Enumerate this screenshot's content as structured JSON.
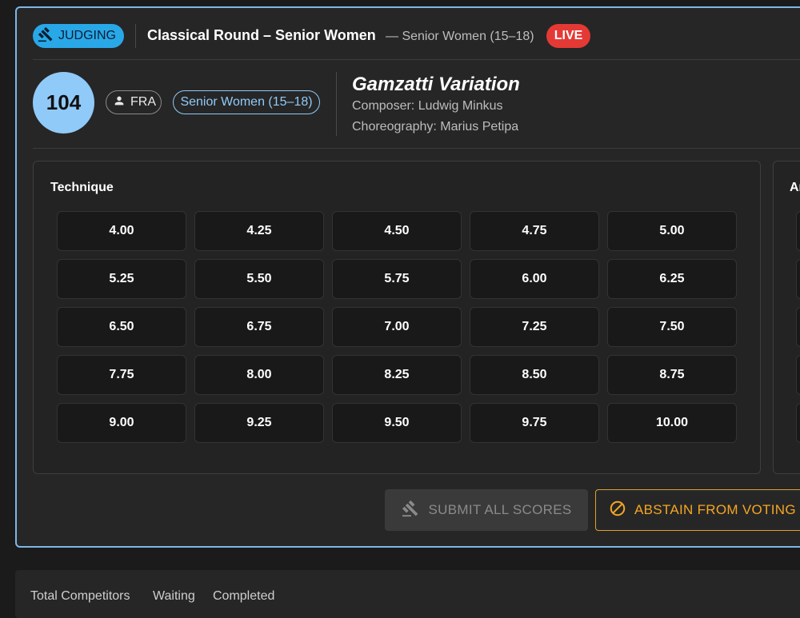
{
  "header": {
    "mode_badge": "JUDGING",
    "round_title": "Classical Round – Senior Women",
    "round_subtitle": "— Senior Women (15–18)",
    "live_badge": "LIVE"
  },
  "competitor": {
    "bib_number": "104",
    "country": "FRA",
    "category": "Senior Women (15–18)",
    "piece_title": "Gamzatti Variation",
    "composer": "Composer: Ludwig Minkus",
    "choreography": "Choreography: Marius Petipa"
  },
  "technique": {
    "title": "Technique",
    "scores": [
      "4.00",
      "4.25",
      "4.50",
      "4.75",
      "5.00",
      "5.25",
      "5.50",
      "5.75",
      "6.00",
      "6.25",
      "6.50",
      "6.75",
      "7.00",
      "7.25",
      "7.50",
      "7.75",
      "8.00",
      "8.25",
      "8.50",
      "8.75",
      "9.00",
      "9.25",
      "9.50",
      "9.75",
      "10.00"
    ]
  },
  "artistry": {
    "title": "Ar"
  },
  "actions": {
    "submit_label": "SUBMIT ALL SCORES",
    "abstain_label": "ABSTAIN FROM VOTING"
  },
  "footer": {
    "total_label": "Total Competitors",
    "waiting_label": "Waiting",
    "completed_label": "Completed"
  },
  "icons": {
    "judging": "gavel-icon",
    "country": "person-icon",
    "submit": "gavel-icon",
    "abstain": "block-icon"
  },
  "colors": {
    "accent": "#29a8e8",
    "panel_border": "#7eb6e6",
    "live": "#e53935",
    "bib": "#90caf9",
    "abstain": "#f5a623"
  }
}
